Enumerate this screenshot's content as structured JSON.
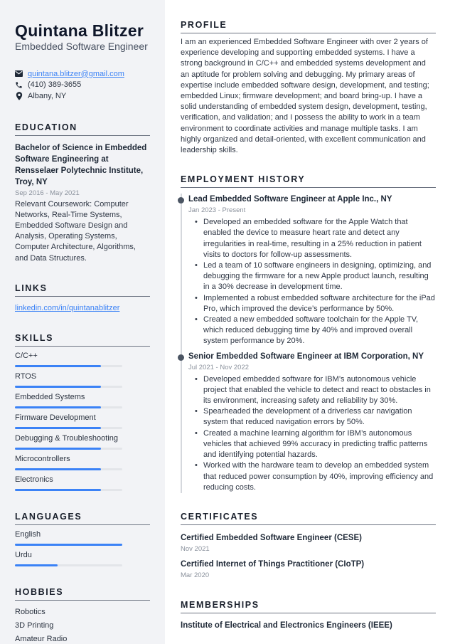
{
  "header": {
    "name": "Quintana Blitzer",
    "title": "Embedded Software Engineer"
  },
  "contact": {
    "email": "quintana.blitzer@gmail.com",
    "email_icon": "envelope-icon",
    "phone": "(410) 389-3655",
    "phone_icon": "phone-icon",
    "location": "Albany, NY",
    "location_icon": "map-pin-icon"
  },
  "education": {
    "heading": "EDUCATION",
    "entries": [
      {
        "title": "Bachelor of Science in Embedded Software Engineering at Rensselaer Polytechnic Institute, Troy, NY",
        "dates": "Sep 2016 - May 2021",
        "description": "Relevant Coursework: Computer Networks, Real-Time Systems, Embedded Software Design and Analysis, Operating Systems, Computer Architecture, Algorithms, and Data Structures."
      }
    ]
  },
  "links": {
    "heading": "LINKS",
    "items": [
      {
        "label": "linkedin.com/in/quintanablitzer"
      }
    ]
  },
  "skills": {
    "heading": "SKILLS",
    "items": [
      {
        "label": "C/C++",
        "level": 0.8
      },
      {
        "label": "RTOS",
        "level": 0.8
      },
      {
        "label": "Embedded Systems",
        "level": 0.8
      },
      {
        "label": "Firmware Development",
        "level": 0.8
      },
      {
        "label": "Debugging & Troubleshooting",
        "level": 0.8
      },
      {
        "label": "Microcontrollers",
        "level": 0.8
      },
      {
        "label": "Electronics",
        "level": 0.8
      }
    ]
  },
  "languages": {
    "heading": "LANGUAGES",
    "items": [
      {
        "label": "English",
        "level": 1.0
      },
      {
        "label": "Urdu",
        "level": 0.4
      }
    ]
  },
  "hobbies": {
    "heading": "HOBBIES",
    "items": [
      "Robotics",
      "3D Printing",
      "Amateur Radio"
    ]
  },
  "profile": {
    "heading": "PROFILE",
    "text": "I am an experienced Embedded Software Engineer with over 2 years of experience developing and supporting embedded systems. I have a strong background in C/C++ and embedded systems development and an aptitude for problem solving and debugging. My primary areas of expertise include embedded software design, development, and testing; embedded Linux; firmware development; and board bring-up. I have a solid understanding of embedded system design, development, testing, verification, and validation; and I possess the ability to work in a team environment to coordinate activities and manage multiple tasks. I am highly organized and detail-oriented, with excellent communication and leadership skills."
  },
  "employment": {
    "heading": "EMPLOYMENT HISTORY",
    "jobs": [
      {
        "title": "Lead Embedded Software Engineer at Apple Inc., NY",
        "dates": "Jan 2023 - Present",
        "bullets": [
          "Developed an embedded software for the Apple Watch that enabled the device to measure heart rate and detect any irregularities in real-time, resulting in a 25% reduction in patient visits to doctors for follow-up assessments.",
          "Led a team of 10 software engineers in designing, optimizing, and debugging the firmware for a new Apple product launch, resulting in a 30% decrease in development time.",
          "Implemented a robust embedded software architecture for the iPad Pro, which improved the device’s performance by 50%.",
          "Created a new embedded software toolchain for the Apple TV, which reduced debugging time by 40% and improved overall system performance by 20%."
        ]
      },
      {
        "title": "Senior Embedded Software Engineer at IBM Corporation, NY",
        "dates": "Jul 2021 - Nov 2022",
        "bullets": [
          "Developed embedded software for IBM’s autonomous vehicle project that enabled the vehicle to detect and react to obstacles in its environment, increasing safety and reliability by 30%.",
          "Spearheaded the development of a driverless car navigation system that reduced navigation errors by 50%.",
          "Created a machine learning algorithm for IBM’s autonomous vehicles that achieved 99% accuracy in predicting traffic patterns and identifying potential hazards.",
          "Worked with the hardware team to develop an embedded system that reduced power consumption by 40%, improving efficiency and reducing costs."
        ]
      }
    ]
  },
  "certificates": {
    "heading": "CERTIFICATES",
    "items": [
      {
        "title": "Certified Embedded Software Engineer (CESE)",
        "date": "Nov 2021"
      },
      {
        "title": "Certified Internet of Things Practitioner (CIoTP)",
        "date": "Mar 2020"
      }
    ]
  },
  "memberships": {
    "heading": "MEMBERSHIPS",
    "items": [
      "Institute of Electrical and Electronics Engineers (IEEE)"
    ]
  },
  "colors": {
    "accent": "#3b82f6",
    "sidebar_bg": "#f2f3f6",
    "heading_rule": "#6b7280",
    "text": "#1f2937",
    "muted": "#8a919c"
  }
}
